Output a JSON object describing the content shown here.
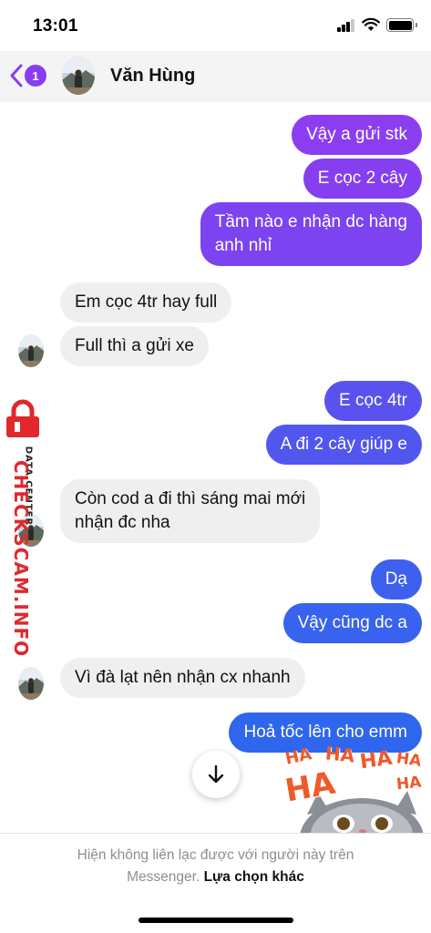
{
  "status_bar": {
    "time": "13:01",
    "battery_level": 1.0
  },
  "header": {
    "unread_count": "1",
    "contact_name": "Văn Hùng"
  },
  "messages": [
    {
      "side": "out",
      "text": "Vậy a gửi stk"
    },
    {
      "side": "out",
      "text": "E cọc 2 cây"
    },
    {
      "side": "out",
      "lines": [
        "Tầm nào e nhận dc hàng",
        "anh nhỉ"
      ]
    },
    {
      "side": "in",
      "text": "Em cọc 4tr hay full"
    },
    {
      "side": "in",
      "text": "Full thì a gửi xe"
    },
    {
      "side": "out",
      "text": "E cọc 4tr"
    },
    {
      "side": "out",
      "text": "A đi 2 cây giúp e"
    },
    {
      "side": "in",
      "lines": [
        "Còn cod a đi thì sáng mai mới",
        "nhận đc nha"
      ]
    },
    {
      "side": "out",
      "text": "Dạ"
    },
    {
      "side": "out",
      "text": "Vậy cũng dc a"
    },
    {
      "side": "in",
      "text": "Vì đà lạt nên nhận cx nhanh"
    },
    {
      "side": "out",
      "text": "Hoả tốc lên cho emm"
    }
  ],
  "watermark": {
    "main": "CHECKSCAM.INFO",
    "sub": "DATA CENTER"
  },
  "sticker": {
    "words": [
      "HA",
      "HA",
      "HA",
      "HA",
      "HA",
      "HA"
    ]
  },
  "footer": {
    "notice": "Hiện không liên lạc được với người này trên",
    "notice_line2": "Messenger.",
    "link": "Lựa chọn khác"
  },
  "icons": {
    "back": "chevron-left-icon",
    "scroll": "arrow-down-icon",
    "watermark_lock": "lock-icon"
  },
  "colors": {
    "bubble_out_top": "#8a3df0",
    "bubble_out_bottom": "#2f66ee",
    "bubble_in": "#efefef",
    "accent": "#8a3df0",
    "watermark_red": "#e0282e"
  }
}
